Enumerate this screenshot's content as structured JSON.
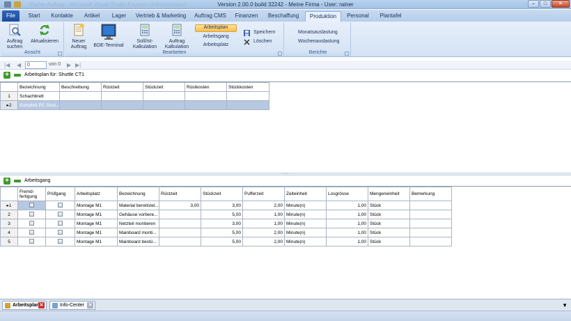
{
  "window": {
    "title": "Version 2.00.0  build 32242 - Meine Firma - User: rainer",
    "ghost_title": "Planer Auftrag - Microsoft Visual Studio Express (Administrator)"
  },
  "file_tab": "File",
  "tabs": [
    "Start",
    "Kontakte",
    "Artikel",
    "Lager",
    "Vertrieb & Marketing",
    "Auftrag CMS",
    "Finanzen",
    "Beschaffung",
    "Produktion",
    "Personal",
    "Plantafel"
  ],
  "active_tab": "Produktion",
  "ribbon": {
    "ansicht": {
      "label": "Ansicht",
      "auftrag_suchen_1": "Auftrag",
      "auftrag_suchen_2": "suchen",
      "aktualisieren": "Aktualisieren"
    },
    "bearbeiten": {
      "label": "Bearbeiten",
      "neuer_auftrag_1": "Neuer",
      "neuer_auftrag_2": "Auftrag",
      "bde_terminal": "BDE-Terminal",
      "soll_ist_1": "Soll/Ist-",
      "soll_ist_2": "Kalkulation",
      "auftrag_kalk_1": "Auftrag",
      "auftrag_kalk_2": "Kalkulation",
      "arbeitsplan": "Arbeitsplan",
      "arbeitsgang": "Arbeitsgang",
      "arbeitsplatz": "Arbeitsplatz",
      "speichern": "Speichern",
      "loeschen": "Löschen"
    },
    "berichte": {
      "label": "Berichte",
      "monatsauslastung": "Monatsauslastung",
      "wochenauslastung": "Wochenauslastung"
    }
  },
  "navigator": {
    "position": "0",
    "of": "von 0"
  },
  "plan_panel": {
    "title": "Arbeitsplan für: Shuttle CT1",
    "columns": [
      "Bezeichnung",
      "Beschreibung",
      "Rüstzeit",
      "Stückzeit",
      "Rüstkosten",
      "Stückkosten"
    ],
    "rows": [
      {
        "num": "1",
        "bezeichnung": "Schachbrett"
      },
      {
        "num": "2",
        "bezeichnung": "Komplett PC Shut..."
      }
    ]
  },
  "gang_panel": {
    "title": "Arbeitsgang",
    "columns": {
      "fremd_1": "Fremd-",
      "fremd_2": "fertigung",
      "pruefgang": "Prüfgang",
      "arbeitsplatz": "Arbeitsplatz",
      "bezeichnung": "Bezeichnung",
      "ruestzeit": "Rüstzeit",
      "stueckzeit": "Stückzeit",
      "pufferzeit": "Pufferzeit",
      "zeiteinheit": "Zeiteinheit",
      "losgroesse": "Losgrösse",
      "mengeneinheit": "Mengeneinheit",
      "bemerkung": "Bemerkung"
    },
    "rows": [
      {
        "num": "1",
        "arbeitsplatz": "Montage M1",
        "bezeichnung": "Material bereitstel...",
        "ruestzeit": "3,00",
        "stueckzeit": "3,00",
        "pufferzeit": "2,00",
        "zeiteinheit": "Minute(n)",
        "losgroesse": "1,00",
        "mengeneinheit": "Stück"
      },
      {
        "num": "2",
        "arbeitsplatz": "Montage M1",
        "bezeichnung": "Gehäuse vorbere...",
        "ruestzeit": "",
        "stueckzeit": "5,00",
        "pufferzeit": "1,00",
        "zeiteinheit": "Minute(n)",
        "losgroesse": "1,00",
        "mengeneinheit": "Stück"
      },
      {
        "num": "3",
        "arbeitsplatz": "Montage M1",
        "bezeichnung": "Netzteil  montieren",
        "ruestzeit": "",
        "stueckzeit": "3,00",
        "pufferzeit": "1,00",
        "zeiteinheit": "Minute(n)",
        "losgroesse": "1,00",
        "mengeneinheit": "Stück"
      },
      {
        "num": "4",
        "arbeitsplatz": "Montage M1",
        "bezeichnung": "Mainboard monti...",
        "ruestzeit": "",
        "stueckzeit": "5,00",
        "pufferzeit": "2,00",
        "zeiteinheit": "Minute(n)",
        "losgroesse": "1,00",
        "mengeneinheit": "Stück"
      },
      {
        "num": "5",
        "arbeitsplatz": "Montage M1",
        "bezeichnung": "Mainboard bestü...",
        "ruestzeit": "",
        "stueckzeit": "5,00",
        "pufferzeit": "2,00",
        "zeiteinheit": "Minute(n)",
        "losgroesse": "1,00",
        "mengeneinheit": "Stück"
      }
    ]
  },
  "doc_tabs": {
    "arbeitsplan": "Arbeitsplan",
    "infocenter": "Info-Center"
  },
  "colors": {
    "accent": "#1b4c9b",
    "add_green": "#3f9a2a",
    "selection": "#b7c9e2",
    "close_red": "#c9302c"
  }
}
